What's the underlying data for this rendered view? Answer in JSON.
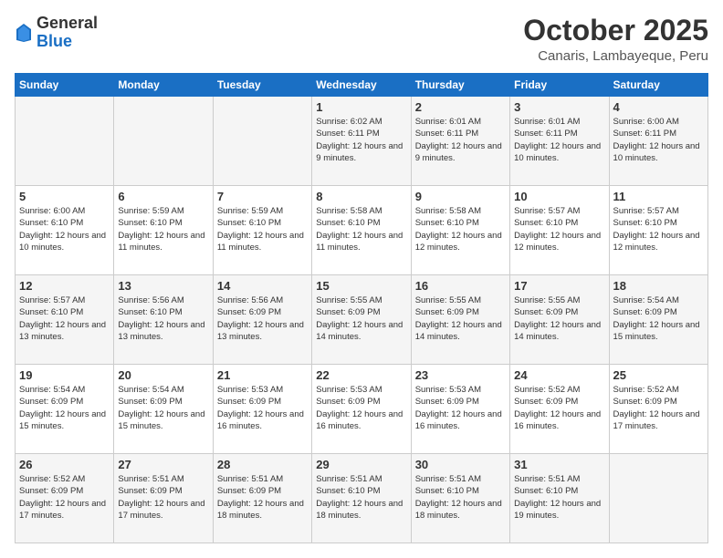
{
  "header": {
    "logo_general": "General",
    "logo_blue": "Blue",
    "month_title": "October 2025",
    "location": "Canaris, Lambayeque, Peru"
  },
  "weekdays": [
    "Sunday",
    "Monday",
    "Tuesday",
    "Wednesday",
    "Thursday",
    "Friday",
    "Saturday"
  ],
  "weeks": [
    [
      {
        "day": "",
        "info": ""
      },
      {
        "day": "",
        "info": ""
      },
      {
        "day": "",
        "info": ""
      },
      {
        "day": "1",
        "info": "Sunrise: 6:02 AM\nSunset: 6:11 PM\nDaylight: 12 hours\nand 9 minutes."
      },
      {
        "day": "2",
        "info": "Sunrise: 6:01 AM\nSunset: 6:11 PM\nDaylight: 12 hours\nand 9 minutes."
      },
      {
        "day": "3",
        "info": "Sunrise: 6:01 AM\nSunset: 6:11 PM\nDaylight: 12 hours\nand 10 minutes."
      },
      {
        "day": "4",
        "info": "Sunrise: 6:00 AM\nSunset: 6:11 PM\nDaylight: 12 hours\nand 10 minutes."
      }
    ],
    [
      {
        "day": "5",
        "info": "Sunrise: 6:00 AM\nSunset: 6:10 PM\nDaylight: 12 hours\nand 10 minutes."
      },
      {
        "day": "6",
        "info": "Sunrise: 5:59 AM\nSunset: 6:10 PM\nDaylight: 12 hours\nand 11 minutes."
      },
      {
        "day": "7",
        "info": "Sunrise: 5:59 AM\nSunset: 6:10 PM\nDaylight: 12 hours\nand 11 minutes."
      },
      {
        "day": "8",
        "info": "Sunrise: 5:58 AM\nSunset: 6:10 PM\nDaylight: 12 hours\nand 11 minutes."
      },
      {
        "day": "9",
        "info": "Sunrise: 5:58 AM\nSunset: 6:10 PM\nDaylight: 12 hours\nand 12 minutes."
      },
      {
        "day": "10",
        "info": "Sunrise: 5:57 AM\nSunset: 6:10 PM\nDaylight: 12 hours\nand 12 minutes."
      },
      {
        "day": "11",
        "info": "Sunrise: 5:57 AM\nSunset: 6:10 PM\nDaylight: 12 hours\nand 12 minutes."
      }
    ],
    [
      {
        "day": "12",
        "info": "Sunrise: 5:57 AM\nSunset: 6:10 PM\nDaylight: 12 hours\nand 13 minutes."
      },
      {
        "day": "13",
        "info": "Sunrise: 5:56 AM\nSunset: 6:10 PM\nDaylight: 12 hours\nand 13 minutes."
      },
      {
        "day": "14",
        "info": "Sunrise: 5:56 AM\nSunset: 6:09 PM\nDaylight: 12 hours\nand 13 minutes."
      },
      {
        "day": "15",
        "info": "Sunrise: 5:55 AM\nSunset: 6:09 PM\nDaylight: 12 hours\nand 14 minutes."
      },
      {
        "day": "16",
        "info": "Sunrise: 5:55 AM\nSunset: 6:09 PM\nDaylight: 12 hours\nand 14 minutes."
      },
      {
        "day": "17",
        "info": "Sunrise: 5:55 AM\nSunset: 6:09 PM\nDaylight: 12 hours\nand 14 minutes."
      },
      {
        "day": "18",
        "info": "Sunrise: 5:54 AM\nSunset: 6:09 PM\nDaylight: 12 hours\nand 15 minutes."
      }
    ],
    [
      {
        "day": "19",
        "info": "Sunrise: 5:54 AM\nSunset: 6:09 PM\nDaylight: 12 hours\nand 15 minutes."
      },
      {
        "day": "20",
        "info": "Sunrise: 5:54 AM\nSunset: 6:09 PM\nDaylight: 12 hours\nand 15 minutes."
      },
      {
        "day": "21",
        "info": "Sunrise: 5:53 AM\nSunset: 6:09 PM\nDaylight: 12 hours\nand 16 minutes."
      },
      {
        "day": "22",
        "info": "Sunrise: 5:53 AM\nSunset: 6:09 PM\nDaylight: 12 hours\nand 16 minutes."
      },
      {
        "day": "23",
        "info": "Sunrise: 5:53 AM\nSunset: 6:09 PM\nDaylight: 12 hours\nand 16 minutes."
      },
      {
        "day": "24",
        "info": "Sunrise: 5:52 AM\nSunset: 6:09 PM\nDaylight: 12 hours\nand 16 minutes."
      },
      {
        "day": "25",
        "info": "Sunrise: 5:52 AM\nSunset: 6:09 PM\nDaylight: 12 hours\nand 17 minutes."
      }
    ],
    [
      {
        "day": "26",
        "info": "Sunrise: 5:52 AM\nSunset: 6:09 PM\nDaylight: 12 hours\nand 17 minutes."
      },
      {
        "day": "27",
        "info": "Sunrise: 5:51 AM\nSunset: 6:09 PM\nDaylight: 12 hours\nand 17 minutes."
      },
      {
        "day": "28",
        "info": "Sunrise: 5:51 AM\nSunset: 6:09 PM\nDaylight: 12 hours\nand 18 minutes."
      },
      {
        "day": "29",
        "info": "Sunrise: 5:51 AM\nSunset: 6:10 PM\nDaylight: 12 hours\nand 18 minutes."
      },
      {
        "day": "30",
        "info": "Sunrise: 5:51 AM\nSunset: 6:10 PM\nDaylight: 12 hours\nand 18 minutes."
      },
      {
        "day": "31",
        "info": "Sunrise: 5:51 AM\nSunset: 6:10 PM\nDaylight: 12 hours\nand 19 minutes."
      },
      {
        "day": "",
        "info": ""
      }
    ]
  ]
}
